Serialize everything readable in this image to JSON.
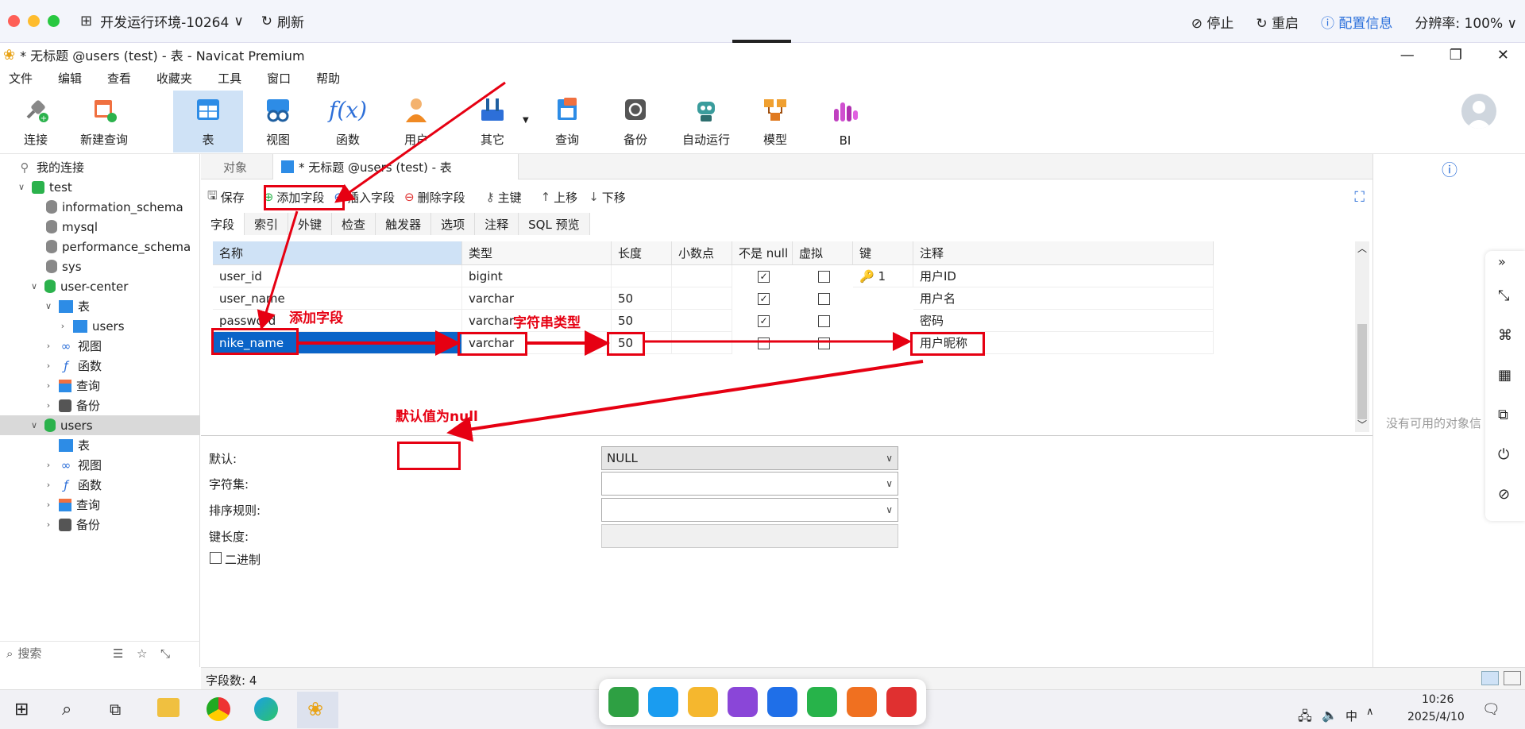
{
  "remote_bar": {
    "env_title": "开发运行环境-10264",
    "refresh": "刷新",
    "stop": "停止",
    "restart": "重启",
    "config": "配置信息",
    "resolution": "分辨率: 100%"
  },
  "window": {
    "title": "* 无标题 @users (test) - 表 - Navicat Premium"
  },
  "menu": [
    "文件",
    "编辑",
    "查看",
    "收藏夹",
    "工具",
    "窗口",
    "帮助"
  ],
  "toolbar": {
    "connect": "连接",
    "new_query": "新建查询",
    "table": "表",
    "view": "视图",
    "function": "函数",
    "user": "用户",
    "other": "其它",
    "query": "查询",
    "backup": "备份",
    "automation": "自动运行",
    "model": "模型",
    "bi": "BI"
  },
  "nav": {
    "my_connections": "我的连接",
    "test": "test",
    "information_schema": "information_schema",
    "mysql": "mysql",
    "performance_schema": "performance_schema",
    "sys": "sys",
    "user_center": "user-center",
    "tables": "表",
    "users": "users",
    "views": "视图",
    "functions": "函数",
    "queries": "查询",
    "backups": "备份",
    "users_db": "users",
    "users_tables": "表",
    "users_views": "视图",
    "users_functions": "函数",
    "users_queries": "查询",
    "users_backups": "备份",
    "search_placeholder": "搜索"
  },
  "tabs": {
    "objects": "对象",
    "current": "* 无标题 @users (test) - 表"
  },
  "editor_toolbar": {
    "save": "保存",
    "add_field": "添加字段",
    "insert_field": "插入字段",
    "delete_field": "删除字段",
    "primary_key": "主键",
    "move_up": "上移",
    "move_down": "下移"
  },
  "subtabs": [
    "字段",
    "索引",
    "外键",
    "检查",
    "触发器",
    "选项",
    "注释",
    "SQL 预览"
  ],
  "grid": {
    "headers": [
      "名称",
      "类型",
      "长度",
      "小数点",
      "不是 null",
      "虚拟",
      "键",
      "注释"
    ],
    "rows": [
      {
        "name": "user_id",
        "type": "bigint",
        "length": "",
        "notnull": true,
        "virtual": false,
        "key": "1",
        "comment": "用户ID"
      },
      {
        "name": "user_name",
        "type": "varchar",
        "length": "50",
        "notnull": true,
        "virtual": false,
        "key": "",
        "comment": "用户名"
      },
      {
        "name": "password",
        "type": "varchar",
        "length": "50",
        "notnull": true,
        "virtual": false,
        "key": "",
        "comment": "密码"
      },
      {
        "name": "nike_name",
        "type": "varchar",
        "length": "50",
        "notnull": false,
        "virtual": false,
        "key": "",
        "comment": "用户昵称"
      }
    ]
  },
  "props": {
    "default_label": "默认:",
    "default_value": "NULL",
    "charset_label": "字符集:",
    "collation_label": "排序规则:",
    "keylen_label": "键长度:",
    "binary_label": "二进制"
  },
  "annotations": {
    "add_field": "添加字段",
    "string_type": "字符串类型",
    "default_null": "默认值为null"
  },
  "right_pane": {
    "no_object": "没有可用的对象信"
  },
  "status": {
    "field_count": "字段数: 4"
  },
  "taskbar": {
    "time": "10:26",
    "date": "2025/4/10",
    "ime": "中"
  },
  "colors": {
    "accent": "#e60012",
    "selection": "#0a64c8",
    "nav_selection": "#d9d9d9"
  }
}
